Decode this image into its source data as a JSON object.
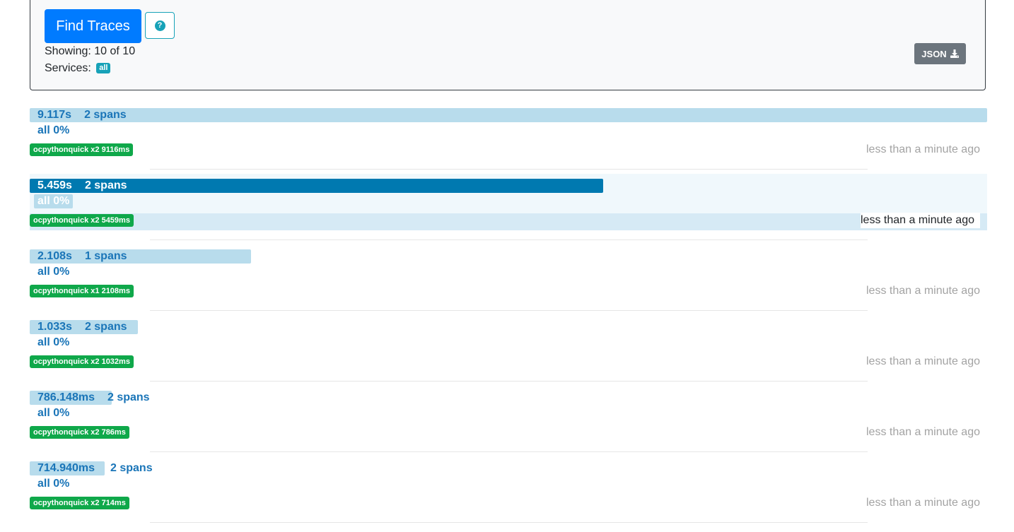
{
  "search": {
    "find_button": "Find Traces",
    "showing": "Showing: 10 of 10",
    "services_label": "Services:",
    "services_badge": "all",
    "json_button": "JSON"
  },
  "traces": [
    {
      "duration": "9.117s",
      "spans": "2 spans",
      "service_pct": "all 0%",
      "badge": "ocpythonquick x2 9116ms",
      "time_ago": "less than a minute ago",
      "duration_fraction": 1.0
    },
    {
      "duration": "5.459s",
      "spans": "2 spans",
      "service_pct": "all 0%",
      "badge": "ocpythonquick x2 5459ms",
      "time_ago": "less than a minute ago",
      "duration_fraction": 0.599
    },
    {
      "duration": "2.108s",
      "spans": "1 spans",
      "service_pct": "all 0%",
      "badge": "ocpythonquick x1 2108ms",
      "time_ago": "less than a minute ago",
      "duration_fraction": 0.231
    },
    {
      "duration": "1.033s",
      "spans": "2 spans",
      "service_pct": "all 0%",
      "badge": "ocpythonquick x2 1032ms",
      "time_ago": "less than a minute ago",
      "duration_fraction": 0.113
    },
    {
      "duration": "786.148ms",
      "spans": "2 spans",
      "service_pct": "all 0%",
      "badge": "ocpythonquick x2 786ms",
      "time_ago": "less than a minute ago",
      "duration_fraction": 0.086
    },
    {
      "duration": "714.940ms",
      "spans": "2 spans",
      "service_pct": "all 0%",
      "badge": "ocpythonquick x2 714ms",
      "time_ago": "less than a minute ago",
      "duration_fraction": 0.078
    }
  ],
  "colors": {
    "primary": "#007bff",
    "info": "#17a2b8",
    "bar": "#b8dcec",
    "bar_hover": "#0079b0",
    "badge_green": "#0fa84a",
    "text_blue": "#1a75b8"
  }
}
